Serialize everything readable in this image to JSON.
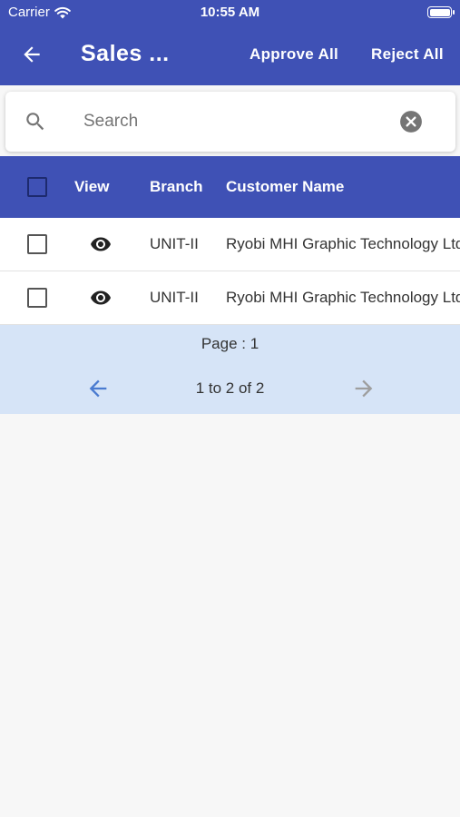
{
  "status_bar": {
    "carrier": "Carrier",
    "time": "10:55 AM"
  },
  "app_bar": {
    "title": "Sales ...",
    "approve_all": "Approve All",
    "reject_all": "Reject All"
  },
  "search": {
    "placeholder": "Search",
    "value": ""
  },
  "table": {
    "headers": {
      "view": "View",
      "branch": "Branch",
      "customer_name": "Customer Name"
    },
    "rows": [
      {
        "branch": "UNIT-II",
        "customer_name": "Ryobi MHI Graphic Technology Ltd"
      },
      {
        "branch": "UNIT-II",
        "customer_name": "Ryobi MHI Graphic Technology Ltd"
      }
    ]
  },
  "pagination": {
    "page_label": "Page : 1",
    "range": "1 to 2 of 2"
  },
  "colors": {
    "primary": "#3f51b5",
    "pager_background": "#d6e4f7",
    "prev_arrow_active": "#4a7bd0",
    "next_arrow_disabled": "#9e9e9e"
  },
  "icons": [
    "back-arrow-icon",
    "wifi-icon",
    "battery-icon",
    "search-icon",
    "clear-icon",
    "eye-icon",
    "arrow-left-icon",
    "arrow-right-icon"
  ]
}
